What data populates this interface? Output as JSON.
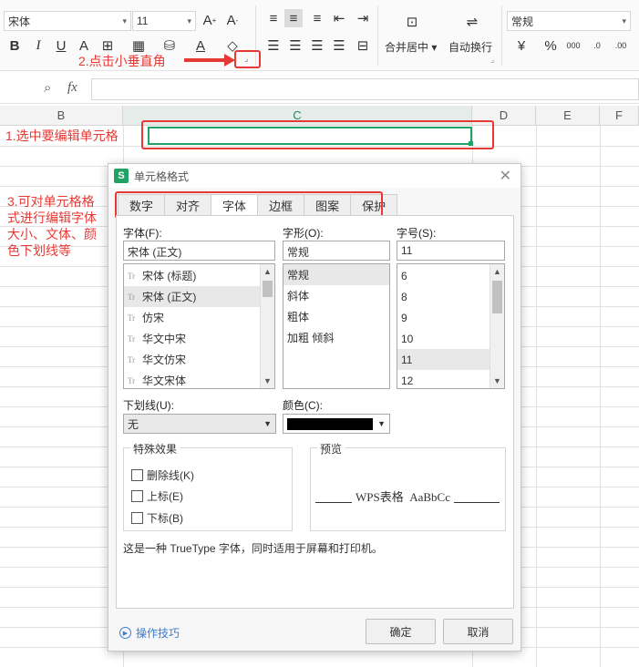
{
  "ribbon": {
    "font_name": "宋体",
    "font_size": "11",
    "number_format": "常规",
    "merge_label": "合并居中",
    "wrap_label": "自动换行",
    "currency": "¥",
    "percent": "%"
  },
  "formula_bar": {
    "fx": "fx"
  },
  "columns": [
    "B",
    "C",
    "D",
    "E",
    "F"
  ],
  "annotations": {
    "step1": "1.选中要编辑单元格",
    "step2": "2.点击小垂直角",
    "step3": "3.可对单元格格式进行编辑字体大小、文体、颜色下划线等"
  },
  "dialog": {
    "title": "单元格格式",
    "tabs": [
      "数字",
      "对齐",
      "字体",
      "边框",
      "图案",
      "保护"
    ],
    "active_tab": "字体",
    "font_label": "字体(F):",
    "font_value": "宋体 (正文)",
    "font_list": [
      "宋体 (标题)",
      "宋体 (正文)",
      "仿宋",
      "华文中宋",
      "华文仿宋",
      "华文宋体"
    ],
    "style_label": "字形(O):",
    "style_value": "常规",
    "style_list": [
      "常规",
      "斜体",
      "粗体",
      "加粗 倾斜"
    ],
    "size_label": "字号(S):",
    "size_value": "11",
    "size_list": [
      "6",
      "8",
      "9",
      "10",
      "11",
      "12"
    ],
    "underline_label": "下划线(U):",
    "underline_value": "无",
    "color_label": "颜色(C):",
    "color_value": "#000000",
    "effects_title": "特殊效果",
    "effects": [
      "删除线(K)",
      "上标(E)",
      "下标(B)"
    ],
    "preview_title": "预览",
    "preview_text": "WPS表格  AaBbCc",
    "info": "这是一种 TrueType 字体，同时适用于屏幕和打印机。",
    "tips_label": "操作技巧",
    "ok_label": "确定",
    "cancel_label": "取消"
  }
}
